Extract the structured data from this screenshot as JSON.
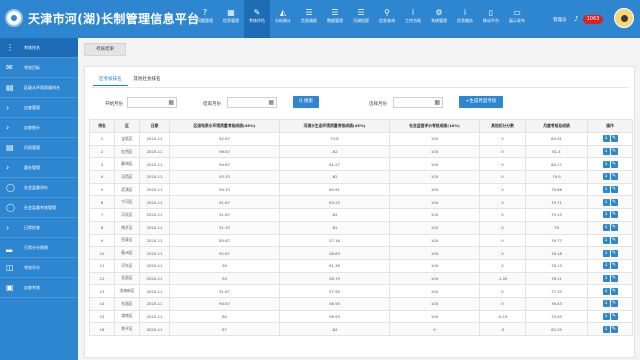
{
  "app": {
    "title": "天津市河(湖)长制管理信息平台"
  },
  "nav": [
    {
      "icon": "question-icon",
      "glyph": "?",
      "label": "问题管理"
    },
    {
      "icon": "report-icon",
      "glyph": "▦",
      "label": "信息管理"
    },
    {
      "icon": "pencil-icon",
      "glyph": "✎",
      "label": "考核评估"
    },
    {
      "icon": "chart-icon",
      "glyph": "◭",
      "label": "分析统计"
    },
    {
      "icon": "list-icon",
      "glyph": "☰",
      "label": "信息填报"
    },
    {
      "icon": "data-icon",
      "glyph": "☰",
      "label": "数据管理"
    },
    {
      "icon": "archive-icon",
      "glyph": "☰",
      "label": "河湖档案"
    },
    {
      "icon": "search-icon",
      "glyph": "⚲",
      "label": "信息查询"
    },
    {
      "icon": "info-icon",
      "glyph": "i",
      "label": "工作台账"
    },
    {
      "icon": "gear-icon",
      "glyph": "⚙",
      "label": "系统管理"
    },
    {
      "icon": "notice-icon",
      "glyph": "i",
      "label": "信息服务"
    },
    {
      "icon": "phone-icon",
      "glyph": "▯",
      "label": "移动平台"
    },
    {
      "icon": "monitor-icon",
      "glyph": "▭",
      "label": "展示发布"
    }
  ],
  "user": {
    "name": "管理员",
    "notifications": "1063"
  },
  "sidebar": [
    {
      "icon": "bars-icon",
      "glyph": "⋮",
      "label": "考核排名"
    },
    {
      "icon": "mail-icon",
      "glyph": "✉",
      "label": "考核目标"
    },
    {
      "icon": "table-icon",
      "glyph": "▤",
      "label": "区级水环境质量排名"
    },
    {
      "icon": "chevron-right-icon",
      "glyph": "›",
      "label": "自查管理"
    },
    {
      "icon": "chevron-right-icon",
      "glyph": "›",
      "label": "自查统计"
    },
    {
      "icon": "stack-icon",
      "glyph": "▤",
      "label": "问责管理"
    },
    {
      "icon": "chevron-right-icon",
      "glyph": "›",
      "label": "督办管理"
    },
    {
      "icon": "chat-icon",
      "glyph": "◯",
      "label": "社会监督评价"
    },
    {
      "icon": "comment-icon",
      "glyph": "◯",
      "label": "社会监督考核管理"
    },
    {
      "icon": "chevron-right-icon",
      "glyph": "›",
      "label": "日常检查"
    },
    {
      "icon": "signal-icon",
      "glyph": "▂",
      "label": "日常计分规则"
    },
    {
      "icon": "trash-icon",
      "glyph": "◫",
      "label": "考核评分"
    },
    {
      "icon": "document-icon",
      "glyph": "▣",
      "label": "自查考核"
    }
  ],
  "page_tab": "考核结果",
  "tabs": [
    "区考核排名",
    "其他社会排名"
  ],
  "filters": {
    "start_label": "开始月份",
    "end_label": "结束月份",
    "search_button": "Q 搜索",
    "select_label": "选择月份",
    "generate_button": "+生成月度考核"
  },
  "table": {
    "headers": [
      "排名",
      "区",
      "日期",
      "区级地表水环境质量考核成绩(45%)",
      "河湖水生态环境质量考核成绩(45%)",
      "社会监督评价考核成绩(10%)",
      "其他扣分分数",
      "月度考核总成绩",
      "操作"
    ],
    "rows": [
      [
        "1",
        "宝坻区",
        "2020-11",
        "92.67",
        "73.8",
        "100",
        "0",
        "84.91"
      ],
      [
        "2",
        "红桥区",
        "2020-11",
        "96.67",
        "-62",
        "100",
        "0",
        "81.4"
      ],
      [
        "3",
        "静海区",
        "2020-11",
        "94.67",
        "61.27",
        "100",
        "0",
        "80.17"
      ],
      [
        "4",
        "河西区",
        "2020-11",
        "93.33",
        "-62",
        "100",
        "0",
        "79.9"
      ],
      [
        "5",
        "武清区",
        "2020-11",
        "94.33",
        "60.91",
        "100",
        "0",
        "79.86"
      ],
      [
        "6",
        "宁河区",
        "2020-11",
        "91.67",
        "63.25",
        "100",
        "0",
        "79.71"
      ],
      [
        "7",
        "河北区",
        "2020-11",
        "91.67",
        "-62",
        "100",
        "0",
        "79.15"
      ],
      [
        "8",
        "南开区",
        "2020-11",
        "91.33",
        "-62",
        "100",
        "0",
        "79"
      ],
      [
        "9",
        "西青区",
        "2020-11",
        "85.67",
        "57.16",
        "100",
        "0",
        "76.77"
      ],
      [
        "10",
        "蓟州区",
        "2020-11",
        "92.67",
        "58.83",
        "100",
        "0",
        "76.18"
      ],
      [
        "11",
        "河东区",
        "2020-11",
        "90",
        "61.39",
        "100",
        "0",
        "78.13"
      ],
      [
        "12",
        "北辰区",
        "2020-11",
        "94",
        "58.79",
        "100",
        "-1.55",
        "78.11"
      ],
      [
        "13",
        "滨海新区",
        "2020-11",
        "91.67",
        "57.95",
        "100",
        "0",
        "77.33"
      ],
      [
        "14",
        "东丽区",
        "2020-11",
        "90.67",
        "56.95",
        "100",
        "0",
        "76.43"
      ],
      [
        "15",
        "津南区",
        "2020-11",
        "80",
        "58.93",
        "100",
        "-0.19",
        "75.93"
      ],
      [
        "16",
        "和平区",
        "2020-11",
        "87",
        "-62",
        "0",
        "-5",
        "62.05"
      ]
    ]
  },
  "colors": {
    "primary": "#2e86d0",
    "active": "#1c6db5",
    "badge": "#e02020"
  }
}
